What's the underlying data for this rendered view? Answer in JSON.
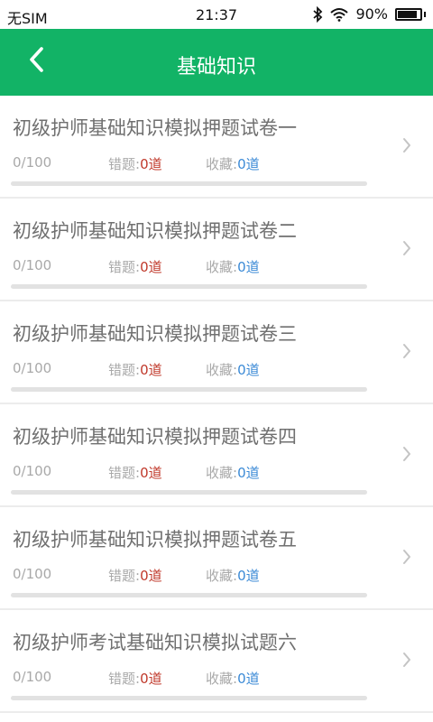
{
  "status_bar": {
    "carrier": "无SIM",
    "time": "21:37",
    "battery": "90%",
    "battery_level": 0.9
  },
  "header": {
    "title": "基础知识",
    "back_icon": "chevron-left-icon"
  },
  "papers": [
    {
      "name": "初级护师基础知识模拟押题试卷一",
      "progress_text": "0/100",
      "progress": 0,
      "wrong_label": "错题:",
      "wrong_value": "0道",
      "fav_label": "收藏:",
      "fav_value": "0道"
    },
    {
      "name": "初级护师基础知识模拟押题试卷二",
      "progress_text": "0/100",
      "progress": 0,
      "wrong_label": "错题:",
      "wrong_value": "0道",
      "fav_label": "收藏:",
      "fav_value": "0道"
    },
    {
      "name": "初级护师基础知识模拟押题试卷三",
      "progress_text": "0/100",
      "progress": 0,
      "wrong_label": "错题:",
      "wrong_value": "0道",
      "fav_label": "收藏:",
      "fav_value": "0道"
    },
    {
      "name": "初级护师基础知识模拟押题试卷四",
      "progress_text": "0/100",
      "progress": 0,
      "wrong_label": "错题:",
      "wrong_value": "0道",
      "fav_label": "收藏:",
      "fav_value": "0道"
    },
    {
      "name": "初级护师基础知识模拟押题试卷五",
      "progress_text": "0/100",
      "progress": 0,
      "wrong_label": "错题:",
      "wrong_value": "0道",
      "fav_label": "收藏:",
      "fav_value": "0道"
    },
    {
      "name": "初级护师考试基础知识模拟试题六",
      "progress_text": "0/100",
      "progress": 0,
      "wrong_label": "错题:",
      "wrong_value": "0道",
      "fav_label": "收藏:",
      "fav_value": "0道"
    }
  ],
  "colors": {
    "brand": "#12b366",
    "wrong": "#c0392b",
    "favorite": "#3b8ad6"
  }
}
